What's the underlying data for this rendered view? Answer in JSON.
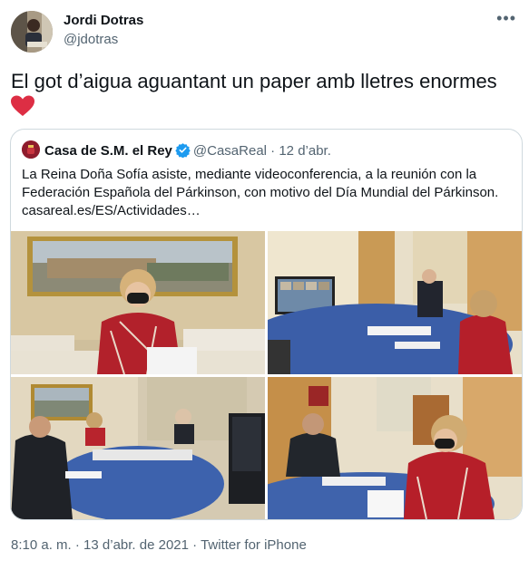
{
  "author": {
    "name": "Jordi Dotras",
    "handle": "@jdotras",
    "avatar_icon": "profile-photo"
  },
  "tweet": {
    "text": "El got d’aigua aguantant un paper amb lletres enormes",
    "emoji": "red-heart-icon",
    "heart_color": "#dd2e44"
  },
  "quoted": {
    "name": "Casa de S.M. el Rey",
    "verified": true,
    "handle": "@CasaReal",
    "separator": "·",
    "date": "12 d’abr.",
    "text": "La Reina Doña Sofía asiste, mediante videoconferencia, a la reunión con la Federación Española del Párkinson, con motivo del Día Mundial del Párkinson. casareal.es/ES/Actividades…",
    "photos": [
      "queen-at-desk-photo",
      "video-conference-table-photo",
      "meeting-room-wide-photo",
      "meeting-closeup-photo"
    ]
  },
  "footer": {
    "time": "8:10 a. m.",
    "sep1": "·",
    "date": "13 d’abr. de 2021",
    "sep2": "·",
    "source": "Twitter for iPhone"
  },
  "colors": {
    "verified_blue": "#1d9bf0",
    "muted_text": "#536471",
    "border": "#cfd9de"
  }
}
